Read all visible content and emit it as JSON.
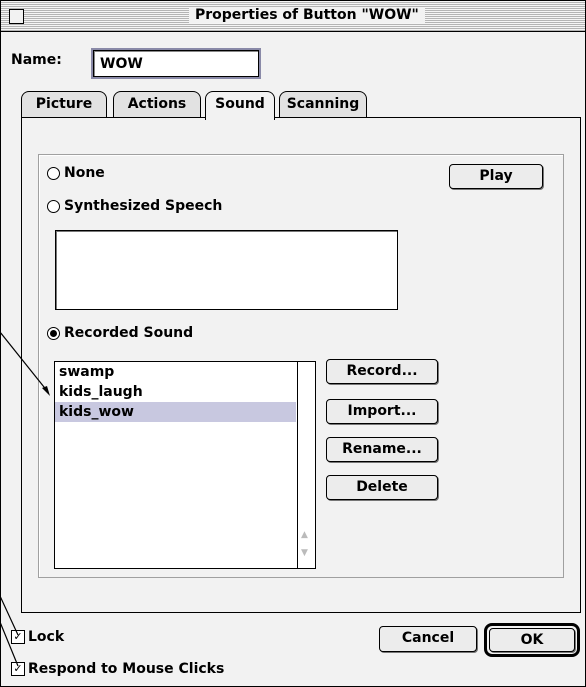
{
  "window": {
    "title": "Properties of Button \"WOW\""
  },
  "name_field": {
    "label": "Name:",
    "value": "WOW"
  },
  "tabs": [
    {
      "label": "Picture",
      "active": false
    },
    {
      "label": "Actions",
      "active": false
    },
    {
      "label": "Sound",
      "active": true
    },
    {
      "label": "Scanning",
      "active": false
    }
  ],
  "sound": {
    "options": {
      "none": "None",
      "synthesized": "Synthesized Speech",
      "recorded": "Recorded Sound"
    },
    "selected_option": "Recorded Sound",
    "play_label": "Play",
    "speech_text": "",
    "recordings": [
      "swamp",
      "kids_laugh",
      "kids_wow"
    ],
    "selected_recording": "kids_wow",
    "buttons": {
      "record": "Record...",
      "import": "Import...",
      "rename": "Rename...",
      "delete": "Delete"
    }
  },
  "footer": {
    "lock_label": "Lock",
    "lock_checked": true,
    "respond_label": "Respond to Mouse Clicks",
    "respond_checked": true,
    "cancel_label": "Cancel",
    "ok_label": "OK"
  },
  "colors": {
    "selection": "#c8c8e0",
    "focus_ring": "#8a8aa8"
  }
}
